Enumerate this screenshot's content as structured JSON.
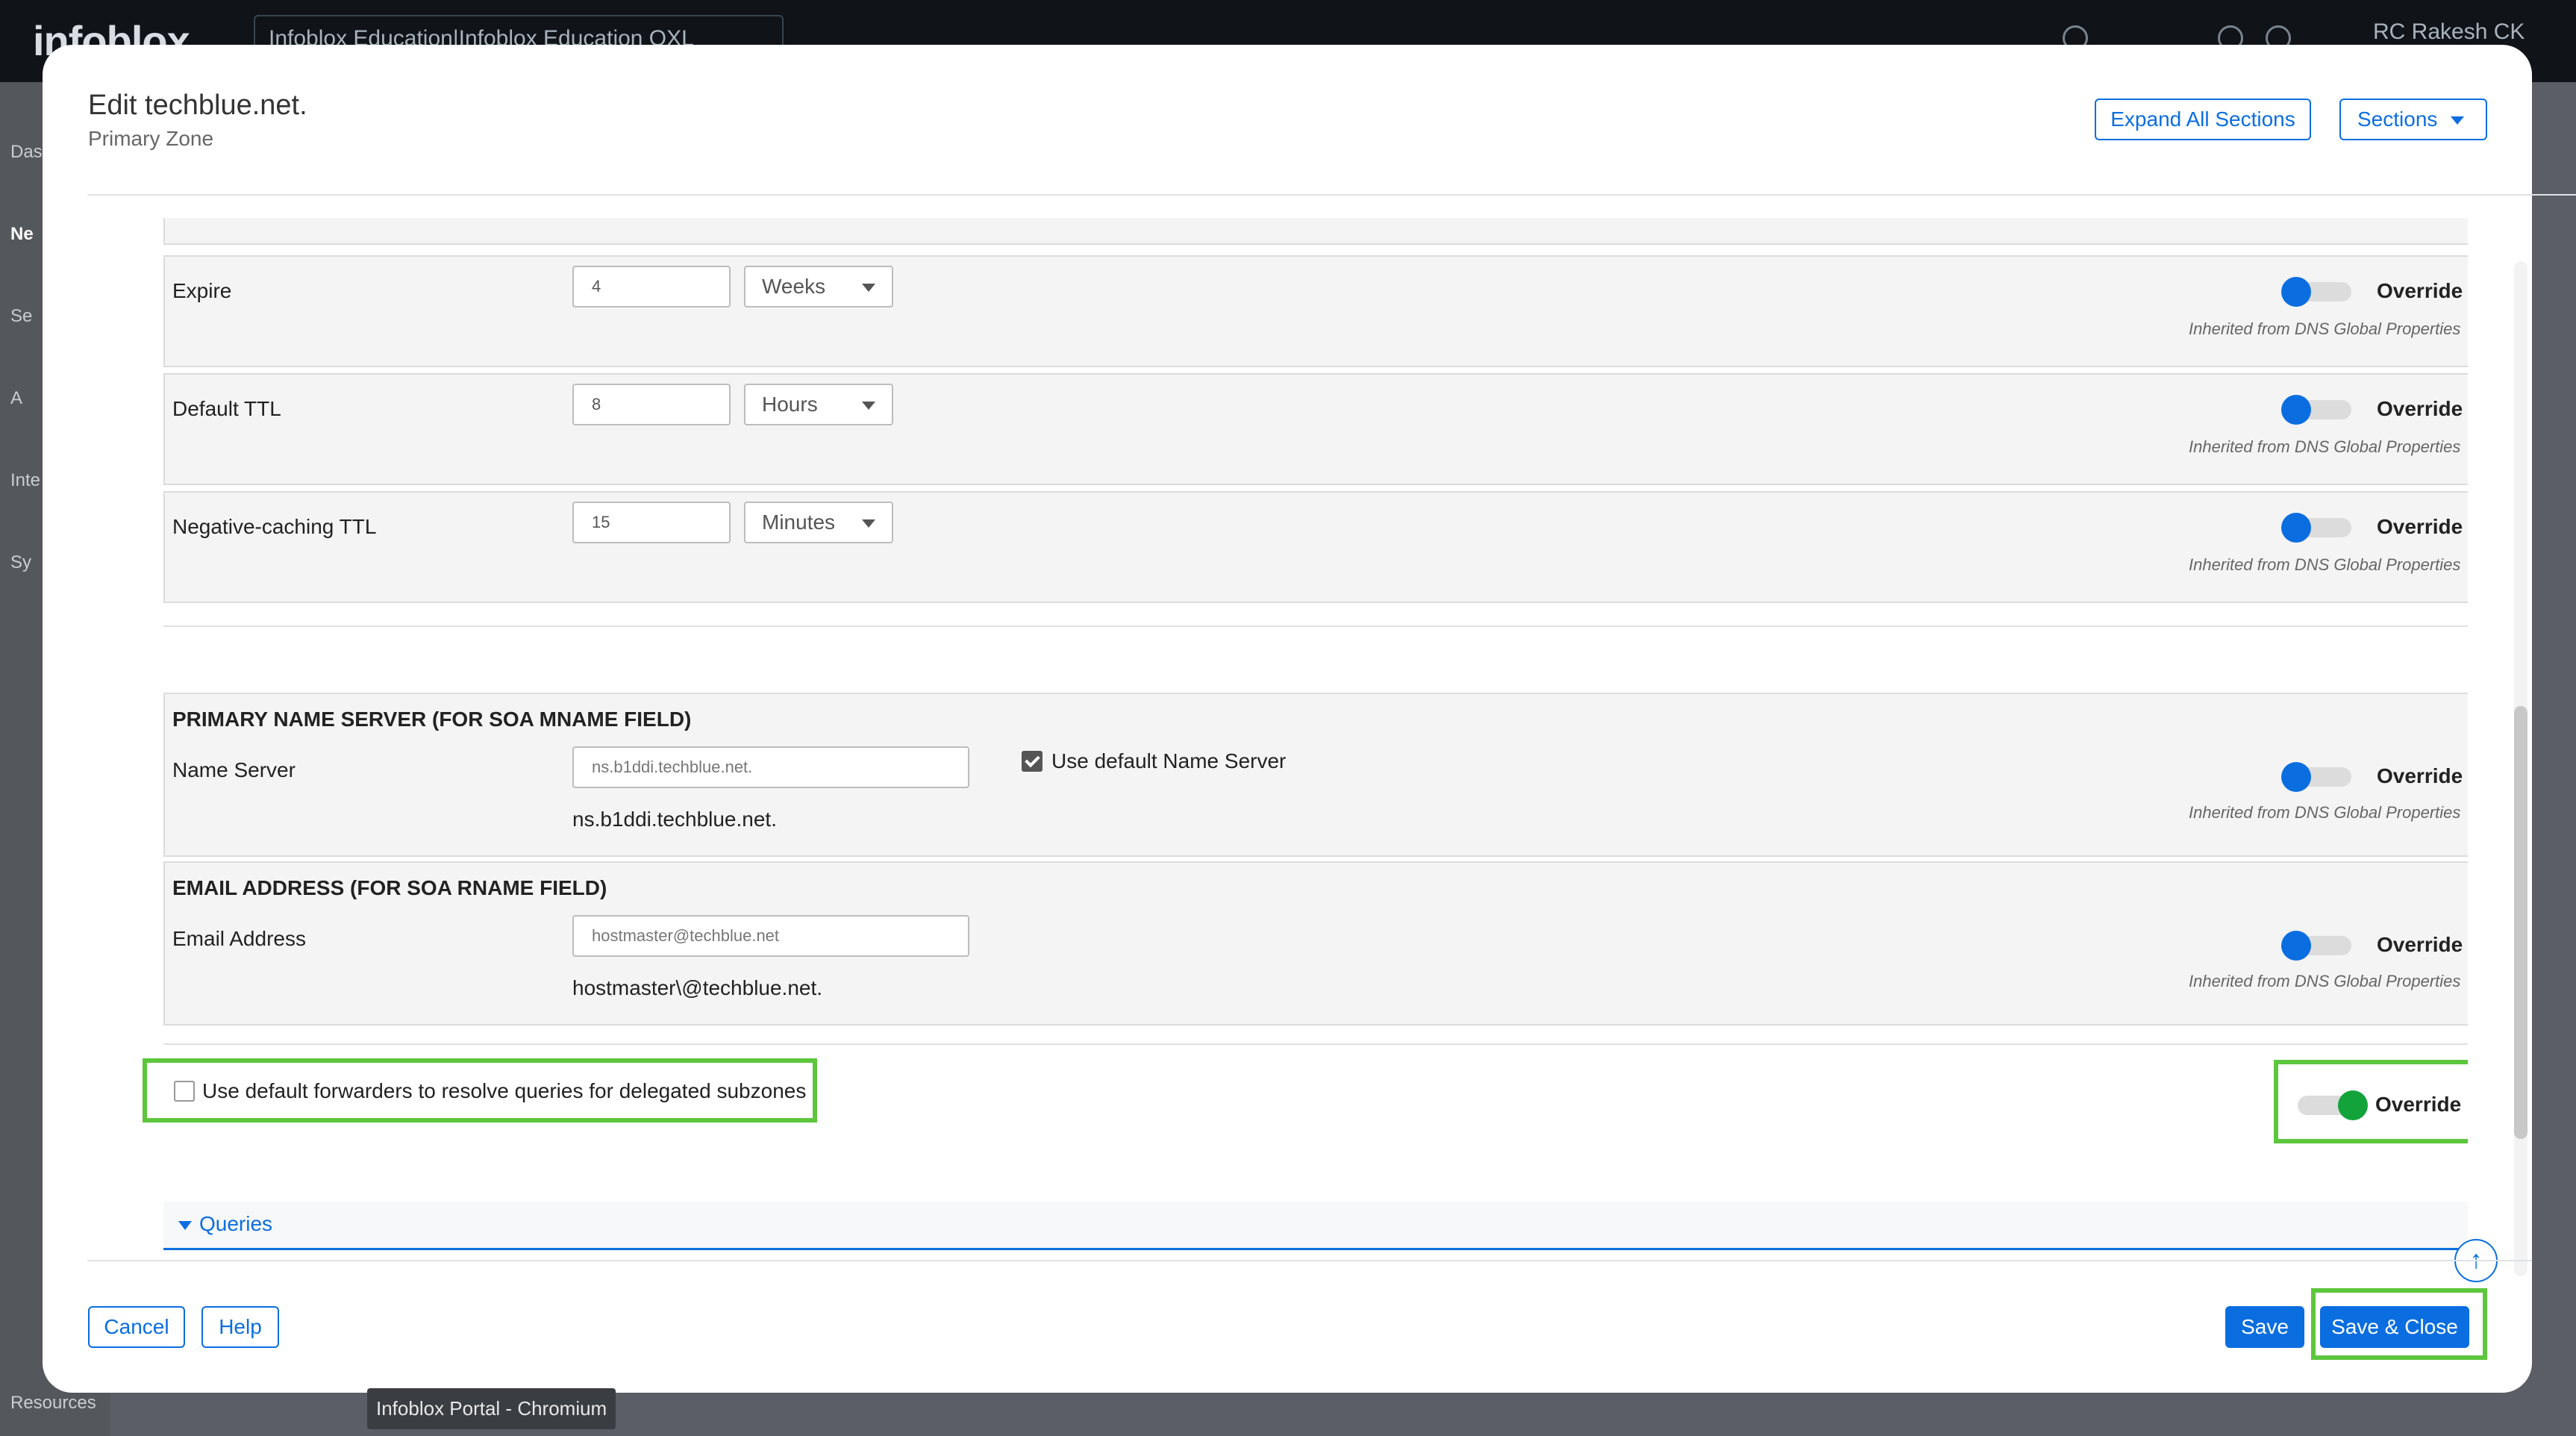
{
  "topbar": {
    "logo": "infoblox",
    "org": "Infoblox Education|Infoblox Education OXL",
    "user": "RC  Rakesh CK"
  },
  "leftnav": [
    "Das",
    "Ne",
    "Se",
    "A",
    "Inte",
    "Sy",
    "Resources"
  ],
  "tooltip": "Infoblox Portal - Chromium",
  "modal": {
    "title": "Edit techblue.net.",
    "subtitle": "Primary Zone",
    "expand_all": "Expand All Sections",
    "sections": "Sections",
    "cancel": "Cancel",
    "help": "Help",
    "save": "Save",
    "save_close": "Save & Close"
  },
  "timers": [
    {
      "label": "Expire",
      "value": "4",
      "unit": "Weeks",
      "override": "Override",
      "inherited": "Inherited from DNS Global Properties"
    },
    {
      "label": "Default TTL",
      "value": "8",
      "unit": "Hours",
      "override": "Override",
      "inherited": "Inherited from DNS Global Properties"
    },
    {
      "label": "Negative-caching TTL",
      "value": "15",
      "unit": "Minutes",
      "override": "Override",
      "inherited": "Inherited from DNS Global Properties"
    }
  ],
  "primary_ns": {
    "header": "PRIMARY NAME SERVER (FOR SOA MNAME FIELD)",
    "label": "Name Server",
    "placeholder": "ns.b1ddi.techblue.net.",
    "checkbox_label": "Use default Name Server",
    "value": "ns.b1ddi.techblue.net.",
    "override": "Override",
    "inherited": "Inherited from DNS Global Properties"
  },
  "email": {
    "header": "EMAIL ADDRESS (FOR SOA RNAME FIELD)",
    "label": "Email Address",
    "placeholder": "hostmaster@techblue.net",
    "value": "hostmaster\\@techblue.net.",
    "override": "Override",
    "inherited": "Inherited from DNS Global Properties"
  },
  "forwarders": {
    "checkbox_label": "Use default forwarders to resolve queries for delegated subzones",
    "override": "Override"
  },
  "queries": {
    "label": "Queries"
  },
  "colors": {
    "accent": "#0b6ee0",
    "toggle_on": "#12a43b",
    "highlight": "#5cc63c"
  }
}
